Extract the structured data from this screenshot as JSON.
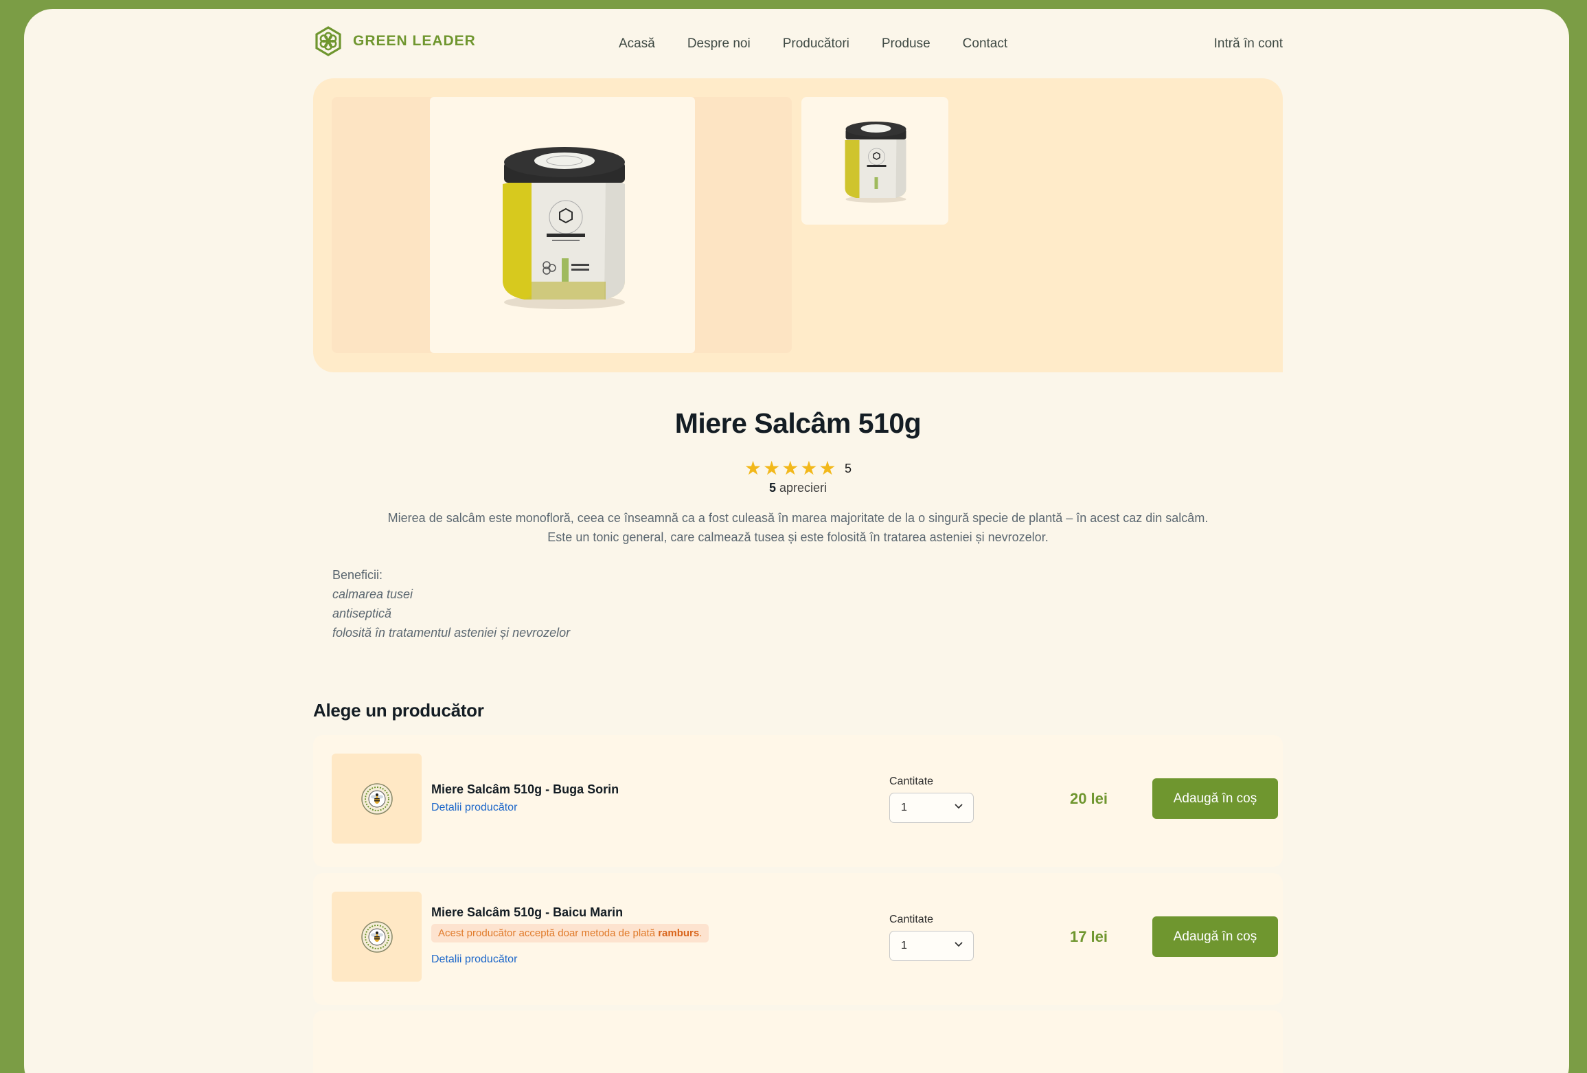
{
  "brand": {
    "name": "GREEN LEADER",
    "color": "#6f962f"
  },
  "nav": {
    "items": [
      {
        "label": "Acasă"
      },
      {
        "label": "Despre noi"
      },
      {
        "label": "Producători"
      },
      {
        "label": "Produse"
      },
      {
        "label": "Contact"
      }
    ],
    "login_label": "Intră în cont"
  },
  "gallery": {
    "main_image": "honey-jar-image",
    "thumbnails": [
      "honey-jar-thumbnail"
    ]
  },
  "product": {
    "title": "Miere Salcâm 510g",
    "rating": {
      "stars": 5,
      "max_stars": 5,
      "value_label": "5"
    },
    "reviews": {
      "count": "5",
      "label": "aprecieri"
    },
    "description": [
      "Mierea de salcâm este monofloră, ceea ce înseamnă ca a fost culeasă în marea majoritate de la o singură specie de plantă – în acest caz din salcâm.",
      "Este un tonic general, care calmează tusea și este folosită în tratarea asteniei și nevrozelor."
    ],
    "benefits": {
      "heading": "Beneficii:",
      "items": [
        "calmarea tusei",
        "antiseptică",
        "folosită în tratamentul asteniei și nevrozelor"
      ]
    }
  },
  "producers": {
    "title": "Alege un producător",
    "list": [
      {
        "name": "Miere Salcâm 510g - Buga Sorin",
        "details_label": "Detalii producător",
        "qty_label": "Cantitate",
        "qty_value": "1",
        "price": "20 lei",
        "add_label": "Adaugă în coș"
      },
      {
        "name": "Miere Salcâm 510g - Baicu Marin",
        "warning_text": "Acest producător acceptă doar metoda de plată ",
        "warning_bold": "ramburs",
        "warning_end": ".",
        "details_label": "Detalii producător",
        "qty_label": "Cantitate",
        "qty_value": "1",
        "price": "17 lei",
        "add_label": "Adaugă în coș"
      }
    ]
  },
  "colors": {
    "background": "#7b9d45",
    "page": "#fbf6ea",
    "accent": "#6f962f",
    "star": "#f2b81b",
    "link": "#1b66c9",
    "warning": "#e07a2a"
  }
}
